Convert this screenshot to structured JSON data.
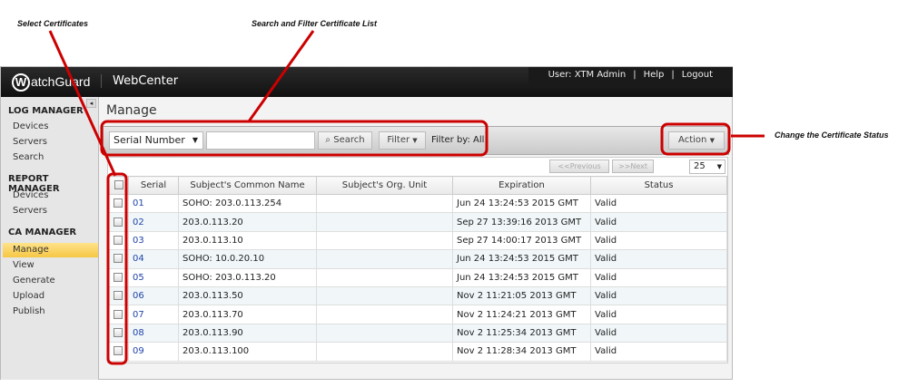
{
  "annotations": {
    "select": "Select Certificates",
    "search": "Search and Filter Certificate List",
    "status": "Change the Certificate Status"
  },
  "header": {
    "logo": "WatchGuard",
    "app": "WebCenter",
    "user": "User: XTM Admin",
    "help": "Help",
    "logout": "Logout",
    "sep": "|"
  },
  "sidebar": {
    "collapse": "◂",
    "sections": [
      {
        "title": "LOG MANAGER",
        "items": [
          "Devices",
          "Servers",
          "Search"
        ]
      },
      {
        "title": "REPORT MANAGER",
        "items": [
          "Devices",
          "Servers"
        ]
      },
      {
        "title": "CA MANAGER",
        "items": [
          "Manage",
          "View",
          "Generate",
          "Upload",
          "Publish"
        ]
      }
    ],
    "selected": "Manage"
  },
  "main": {
    "title": "Manage"
  },
  "toolbar": {
    "field": "Serial Number",
    "search_value": "",
    "search": "Search",
    "filter": "Filter",
    "filter_by": "Filter by: All",
    "action": "Action"
  },
  "pagination": {
    "previous": "<<Previous",
    "next": ">>Next",
    "page_size": "25"
  },
  "table": {
    "columns": [
      "Serial",
      "Subject's Common Name",
      "Subject's Org. Unit",
      "Expiration",
      "Status"
    ],
    "rows": [
      [
        "01",
        "SOHO: 203.0.113.254",
        "",
        "Jun 24 13:24:53 2015 GMT",
        "Valid"
      ],
      [
        "02",
        "203.0.113.20",
        "",
        "Sep 27 13:39:16 2013 GMT",
        "Valid"
      ],
      [
        "03",
        "203.0.113.10",
        "",
        "Sep 27 14:00:17 2013 GMT",
        "Valid"
      ],
      [
        "04",
        "SOHO: 10.0.20.10",
        "",
        "Jun 24 13:24:53 2015 GMT",
        "Valid"
      ],
      [
        "05",
        "SOHO: 203.0.113.20",
        "",
        "Jun 24 13:24:53 2015 GMT",
        "Valid"
      ],
      [
        "06",
        "203.0.113.50",
        "",
        "Nov 2 11:21:05 2013 GMT",
        "Valid"
      ],
      [
        "07",
        "203.0.113.70",
        "",
        "Nov 2 11:24:21 2013 GMT",
        "Valid"
      ],
      [
        "08",
        "203.0.113.90",
        "",
        "Nov 2 11:25:34 2013 GMT",
        "Valid"
      ],
      [
        "09",
        "203.0.113.100",
        "",
        "Nov 2 11:28:34 2013 GMT",
        "Valid"
      ]
    ]
  },
  "colors": {
    "annotation": "#cc0000",
    "selected": "#f6c744"
  }
}
